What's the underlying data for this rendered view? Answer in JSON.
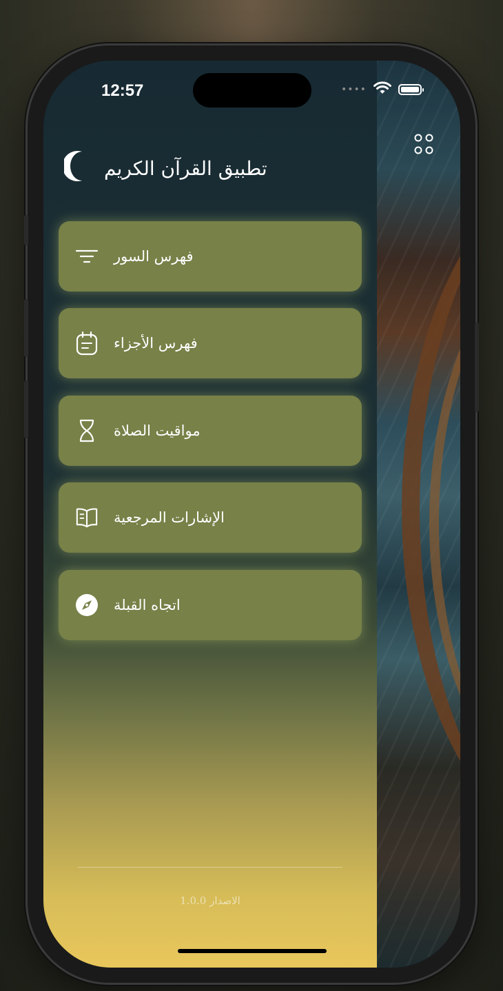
{
  "status_bar": {
    "time": "12:57"
  },
  "app": {
    "title": "تطبيق القرآن الكريم"
  },
  "menu": {
    "items": [
      {
        "label": "فهرس السور",
        "icon": "filter-lines-icon"
      },
      {
        "label": "فهرس الأجزاء",
        "icon": "notepad-icon"
      },
      {
        "label": "مواقيت الصلاة",
        "icon": "hourglass-icon"
      },
      {
        "label": "الإشارات المرجعية",
        "icon": "open-book-icon"
      },
      {
        "label": "اتجاه القبلة",
        "icon": "compass-icon"
      }
    ]
  },
  "footer": {
    "version": "الاصدار 1.0.0"
  },
  "colors": {
    "menu_item_bg": "#778148",
    "drawer_top": "#172a33",
    "drawer_bottom": "#e9c75c"
  }
}
